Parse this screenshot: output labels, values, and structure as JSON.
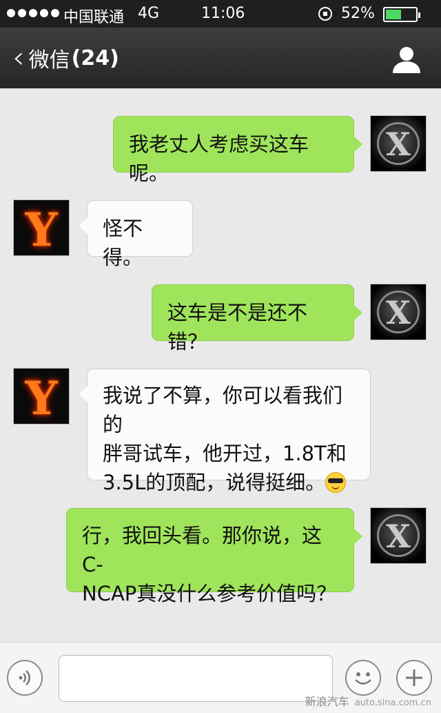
{
  "status_bar": {
    "carrier": "中国联通",
    "network": "4G",
    "time": "11:06",
    "battery_percent": "52%",
    "battery_level": 0.52,
    "battery_color": "#4cd964"
  },
  "nav": {
    "back_label": "微信",
    "unread_count": "(24)",
    "profile_icon": "person-icon"
  },
  "messages": [
    {
      "side": "out",
      "avatar": "x-avatar",
      "text": "我老丈人考虑买这车呢。"
    },
    {
      "side": "in",
      "avatar": "y-avatar",
      "text": "怪不得。"
    },
    {
      "side": "out",
      "avatar": "x-avatar",
      "text": "这车是不是还不错？"
    },
    {
      "side": "in",
      "avatar": "y-avatar",
      "lines": [
        "我说了不算，你可以看我们的",
        "胖哥试车，他开过，1.8T和",
        "3.5L的顶配，说得挺细。"
      ],
      "emoji": "cool-smiley-emoji"
    },
    {
      "side": "out",
      "avatar": "x-avatar",
      "lines": [
        "行，我回头看。那你说，这C-",
        "NCAP真没什么参考价值吗？"
      ]
    }
  ],
  "input_bar": {
    "voice_icon": "voice-icon",
    "emoji_icon": "smiley-icon",
    "plus_icon": "plus-icon",
    "text_value": ""
  },
  "watermark": {
    "brand": "新浪汽车",
    "url": "auto.sina.com.cn"
  },
  "colors": {
    "outgoing_bubble": "#9fe45a",
    "incoming_bubble": "#fbfbfb",
    "nav_background": "#262626"
  }
}
